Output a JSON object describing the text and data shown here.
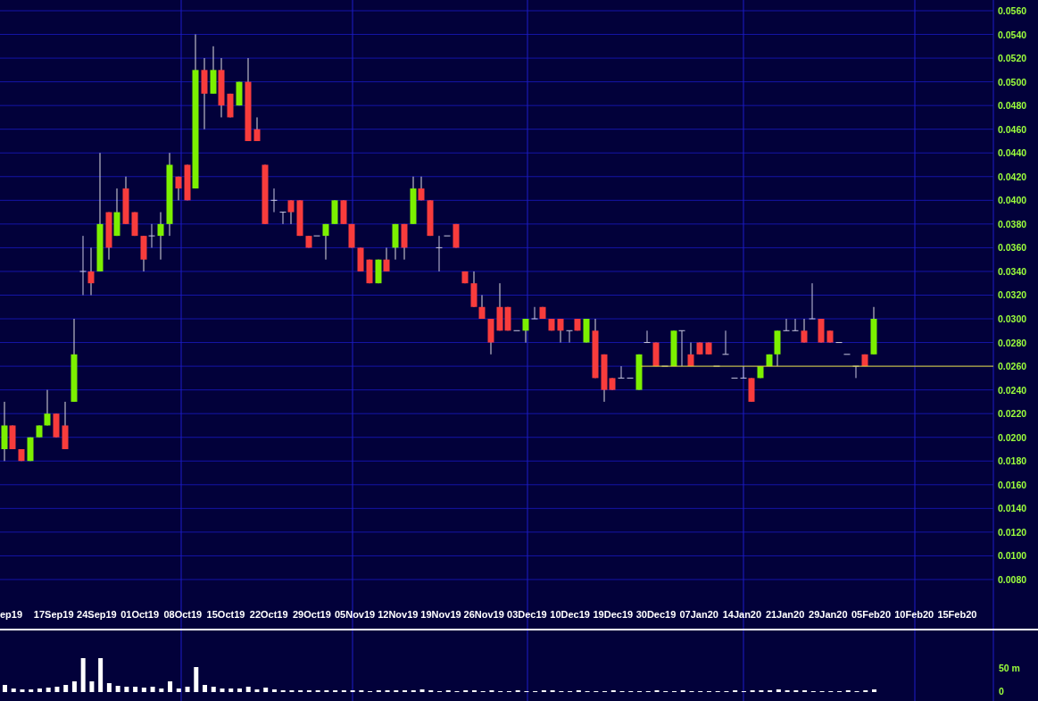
{
  "price_axis": {
    "labels": [
      "0.0560",
      "0.0540",
      "0.0520",
      "0.0500",
      "0.0480",
      "0.0460",
      "0.0440",
      "0.0420",
      "0.0400",
      "0.0380",
      "0.0360",
      "0.0340",
      "0.0320",
      "0.0300",
      "0.0280",
      "0.0260",
      "0.0240",
      "0.0220",
      "0.0200",
      "0.0180",
      "0.0160",
      "0.0140",
      "0.0120",
      "0.0100",
      "0.0080"
    ]
  },
  "date_axis": {
    "labels": [
      "ep19",
      "17Sep19",
      "24Sep19",
      "01Oct19",
      "08Oct19",
      "15Oct19",
      "22Oct19",
      "29Oct19",
      "05Nov19",
      "12Nov19",
      "19Nov19",
      "26Nov19",
      "03Dec19",
      "10Dec19",
      "19Dec19",
      "30Dec19",
      "07Jan20",
      "14Jan20",
      "21Jan20",
      "29Jan20",
      "05Feb20",
      "10Feb20",
      "15Feb20"
    ]
  },
  "volume_axis": {
    "labels": [
      "50 m",
      "0"
    ]
  }
}
